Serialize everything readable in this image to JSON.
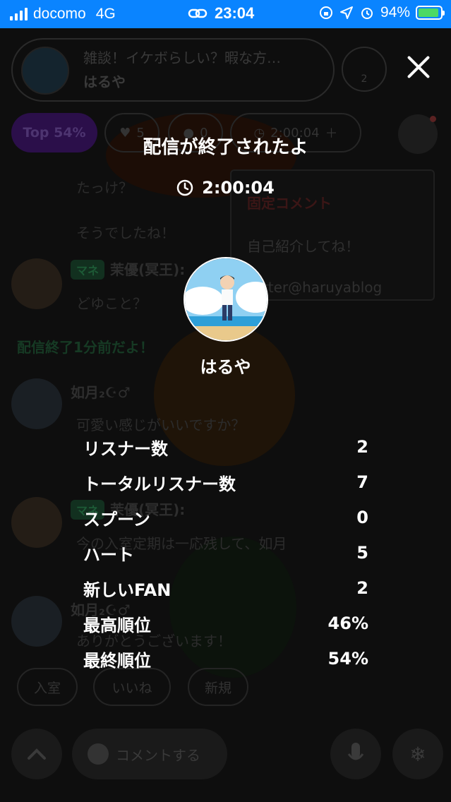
{
  "status_bar": {
    "carrier": "docomo",
    "network": "4G",
    "time": "23:04",
    "battery": "94%",
    "battery_level": 0.94
  },
  "background": {
    "header": {
      "title": "雑談！イケボらしい？暇な方…",
      "name": "はるや",
      "listener_count": "2"
    },
    "top_rank": "Top 54%",
    "like_count": "5",
    "spoon_count": "0",
    "timer": "2:00:04",
    "pinned": {
      "title": "固定コメント",
      "line1": "自己紹介してね！",
      "line2": "witter@haruyablog"
    },
    "chat": [
      "たっけ？",
      "そうでしたね！"
    ],
    "chat_users": [
      {
        "badge": "マネ",
        "name": "茉優(冥王):",
        "message": "どゆこと？"
      },
      {
        "name": "如月₂☪︎♂︎",
        "message": "可愛い感じがいいですか？"
      },
      {
        "badge": "マネ",
        "name": "茉優(冥王):",
        "message": "今の入室定期は一応残して、如月"
      },
      {
        "name": "如月₂☪︎♂︎",
        "message": "ありがとうございます！"
      }
    ],
    "system_message": "配信終了1分前だよ！",
    "chips": [
      "入室",
      "いいね",
      "新規"
    ],
    "comment_placeholder": "コメントする"
  },
  "end_screen": {
    "title": "配信が終了されたよ",
    "duration": "2:00:04",
    "name": "はるや",
    "stats": [
      {
        "label": "リスナー数",
        "value": "2"
      },
      {
        "label": "トータルリスナー数",
        "value": "7"
      },
      {
        "label": "スプーン",
        "value": "0"
      },
      {
        "label": "ハート",
        "value": "5"
      },
      {
        "label": "新しいFAN",
        "value": "2"
      },
      {
        "label": "最高順位",
        "value": "46%"
      },
      {
        "label": "最終順位",
        "value": "54%"
      }
    ]
  },
  "icons": {
    "close": "close-icon",
    "clock": "clock-icon",
    "user": "user-icon",
    "heart": "heart-icon",
    "megaphone": "megaphone-icon",
    "mic": "mic-icon",
    "snowflake": "snowflake-icon",
    "chevron_up": "chevron-up-icon"
  },
  "colors": {
    "status_bar": "#0a84ff",
    "battery": "#4cd964",
    "background": "#000000"
  }
}
